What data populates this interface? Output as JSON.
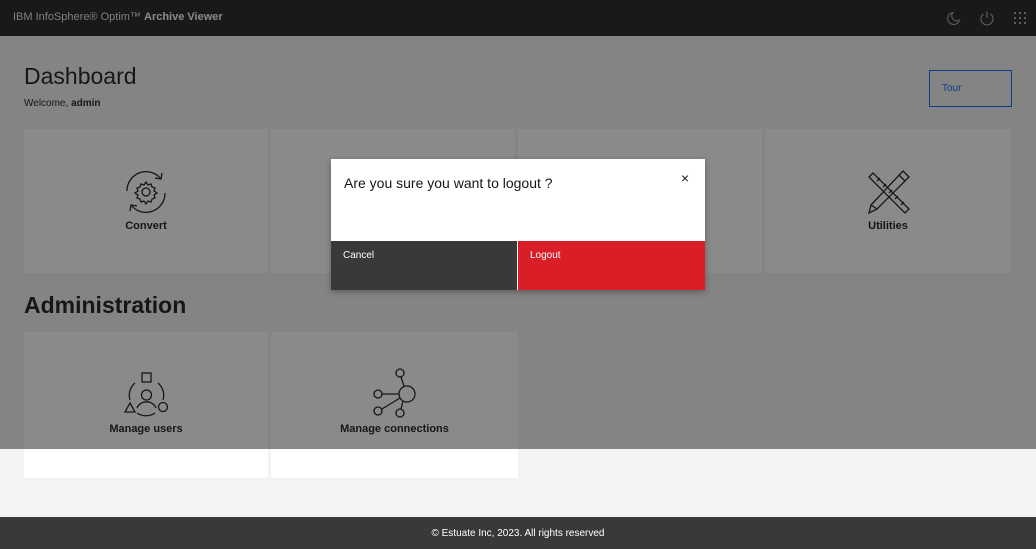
{
  "header": {
    "brand_prefix": "IBM InfoSphere® Optim™",
    "brand_name": "Archive Viewer",
    "icons": [
      "moon-icon",
      "power-icon",
      "app-switcher-icon"
    ]
  },
  "dashboard": {
    "title": "Dashboard",
    "welcome_prefix": "Welcome,",
    "user": "admin",
    "tour_label": "Tour"
  },
  "tiles": [
    {
      "label": "Convert",
      "icon": "convert-gear-icon"
    },
    {
      "label": "",
      "icon": ""
    },
    {
      "label": "",
      "icon": ""
    },
    {
      "label": "Utilities",
      "icon": "utilities-tools-icon"
    }
  ],
  "administration": {
    "title": "Administration",
    "tiles": [
      {
        "label": "Manage users",
        "icon": "manage-users-icon"
      },
      {
        "label": "Manage connections",
        "icon": "connections-icon"
      }
    ]
  },
  "modal": {
    "message": "Are you sure you want to logout ?",
    "close_symbol": "×",
    "cancel_label": "Cancel",
    "logout_label": "Logout"
  },
  "footer": {
    "text": "© Estuate Inc, 2023.  All rights reserved"
  },
  "colors": {
    "topbar": "#1d1d1d",
    "accent_blue": "#0f62fe",
    "danger_red": "#da1e28",
    "footer": "#393939"
  }
}
